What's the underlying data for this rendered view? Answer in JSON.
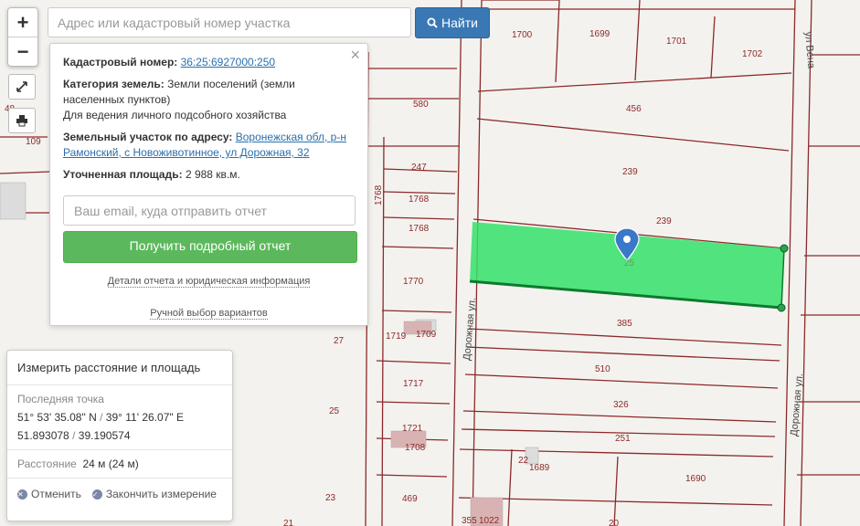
{
  "search": {
    "placeholder": "Адрес или кадастровый номер участка",
    "button_label": "Найти"
  },
  "zoom": {
    "in": "+",
    "out": "−"
  },
  "icons": {
    "search": "search-icon",
    "expand": "expand-icon",
    "print": "print-icon",
    "close": "close-icon",
    "cancel": "x-circle-icon",
    "finish": "check-circle-icon",
    "marker": "map-marker-icon"
  },
  "parcel_info": {
    "cadastral_label": "Кадастровый номер:",
    "cadastral_value": "36:25:6927000:250",
    "category_label": "Категория земель:",
    "category_value": "Земли поселений (земли населенных пунктов)",
    "usage": "Для ведения личного подсобного хозяйства",
    "address_label": "Земельный участок по адресу:",
    "address_value": "Воронежская обл, р-н Рамонский, с Новоживотинное, ул Дорожная, 32",
    "area_label": "Уточненная площадь:",
    "area_value": "2 988 кв.м.",
    "email_placeholder": "Ваш email, куда отправить отчет",
    "report_button": "Получить подробный отчет",
    "details_link": "Детали отчета и юридическая информация",
    "manual_link": "Ручной выбор вариантов",
    "close": "×"
  },
  "measure": {
    "title": "Измерить расстояние и площадь",
    "last_point_label": "Последняя точка",
    "dms_lat": "51° 53' 35.08\" N",
    "dms_lon": "39° 11' 26.07\" E",
    "dec_lat": "51.893078",
    "dec_lon": "39.190574",
    "sep": "/",
    "distance_label": "Расстояние",
    "distance_value": "24 м (24 м)",
    "cancel_label": "Отменить",
    "finish_label": "Закончить измерение"
  },
  "map": {
    "streets": {
      "dorozhnaya_west": "Дорожная ул.",
      "dorozhnaya_east": "Дорожная ул.",
      "top_right": "ул Вена"
    },
    "parcel_labels": [
      "1700",
      "1699",
      "1701",
      "1702",
      "456",
      "580",
      "239",
      "247",
      "1768",
      "1768",
      "1768",
      "239",
      "1770",
      "385",
      "1719",
      "1709",
      "27",
      "510",
      "1717",
      "326",
      "25",
      "1721",
      "1708",
      "251",
      "22",
      "1689",
      "1690",
      "469",
      "23",
      "355",
      "1022",
      "20",
      "21",
      "109",
      "48",
      "25"
    ],
    "highlight_color": "#34e26a",
    "line_color": "#8b2a2a"
  }
}
